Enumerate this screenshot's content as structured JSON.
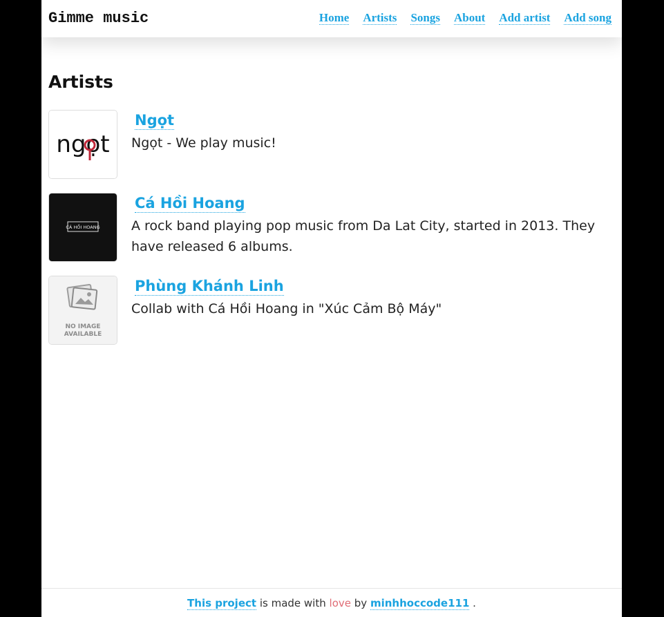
{
  "header": {
    "brand": "Gimme music",
    "nav": [
      "Home",
      "Artists",
      "Songs",
      "About",
      "Add artist",
      "Add song"
    ]
  },
  "main": {
    "title": "Artists",
    "artists": [
      {
        "name": "Ngọt",
        "description": "Ngọt - We play music!",
        "thumbnail_text": "ngọt"
      },
      {
        "name": "Cá Hồi Hoang",
        "description": "A rock band playing pop music from Da Lat City, started in 2013. They have released 6 albums.",
        "thumbnail_text": "CÁ HỒI HOANG"
      },
      {
        "name": "Phùng Khánh Linh",
        "description": "Collab with Cá Hồi Hoang in \"Xúc Cảm Bộ Máy\"",
        "thumbnail_text_line1": "NO IMAGE",
        "thumbnail_text_line2": "AVAILABLE"
      }
    ]
  },
  "footer": {
    "project_link": "This project",
    "made_with": "is made with",
    "love": "love",
    "by": "by",
    "author": "minhhoccode111",
    "end": "."
  },
  "colors": {
    "link": "#1aa3e0",
    "love": "#e06c75",
    "background": "#000000",
    "page": "#ffffff"
  }
}
